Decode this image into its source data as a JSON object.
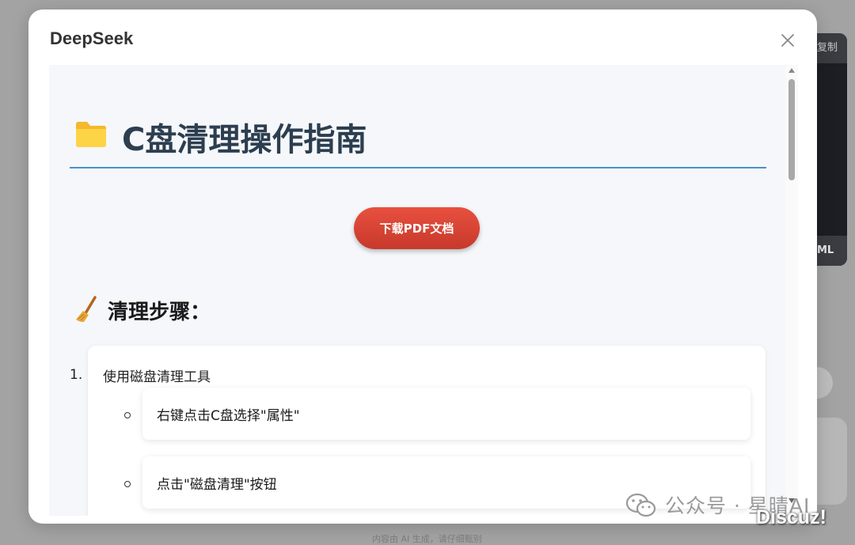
{
  "background": {
    "panel_top_label": "复制",
    "panel_bottom_label": "ML",
    "footer_text": "内容由 AI 生成，请仔细甄别"
  },
  "modal": {
    "title": "DeepSeek",
    "close_icon": "close-icon"
  },
  "document": {
    "title_icon": "folder-icon",
    "title": "C盘清理操作指南",
    "download_label": "下载PDF文档",
    "section_icon": "broom-icon",
    "section_heading": "清理步骤：",
    "steps": [
      {
        "number": "1.",
        "title": "使用磁盘清理工具",
        "substeps": [
          "右键点击C盘选择\"属性\"",
          "点击\"磁盘清理\"按钮"
        ]
      }
    ]
  },
  "watermark": {
    "icon": "wechat-icon",
    "text": "公众号 · 星晴AI",
    "discuz": "Discuz!"
  },
  "colors": {
    "accent_blue": "#4a90c9",
    "button_red": "#d9463a",
    "title_dark": "#2c3e50"
  }
}
